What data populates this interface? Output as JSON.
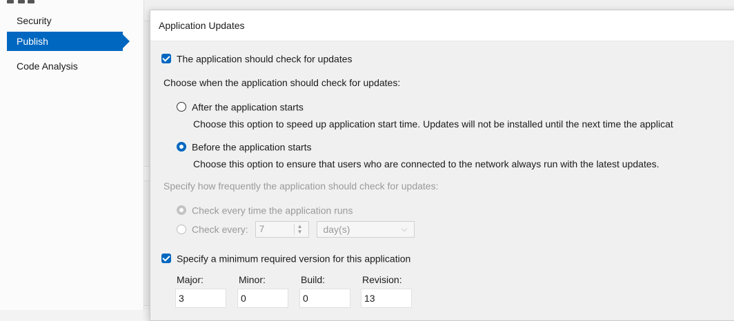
{
  "nav": {
    "items": [
      {
        "label": "Security",
        "active": false
      },
      {
        "label": "Publish",
        "active": true
      },
      {
        "label": "Code Analysis",
        "active": false
      }
    ],
    "accent": "#0067c0"
  },
  "dialog": {
    "title": "Application Updates",
    "check_updates": {
      "label": "The application should check for updates",
      "checked": true
    },
    "when_heading": "Choose when the application should check for updates:",
    "after_start": {
      "label": "After the application starts",
      "desc": "Choose this option to speed up application start time. Updates will not be installed until the next time the applicat",
      "selected": false
    },
    "before_start": {
      "label": "Before the application starts",
      "desc": "Choose this option to ensure that users who are connected to the network always run with the latest updates.",
      "selected": true
    },
    "frequency_heading": "Specify how frequently the application should check for updates:",
    "every_run": {
      "label": "Check every time the application runs",
      "selected": true,
      "enabled": false
    },
    "every_interval": {
      "label": "Check every:",
      "value": "7",
      "unit": "day(s)",
      "enabled": false
    },
    "min_version": {
      "label": "Specify a minimum required version for this application",
      "checked": true,
      "major_label": "Major:",
      "minor_label": "Minor:",
      "build_label": "Build:",
      "revision_label": "Revision:",
      "major": "3",
      "minor": "0",
      "build": "0",
      "revision": "13"
    }
  }
}
